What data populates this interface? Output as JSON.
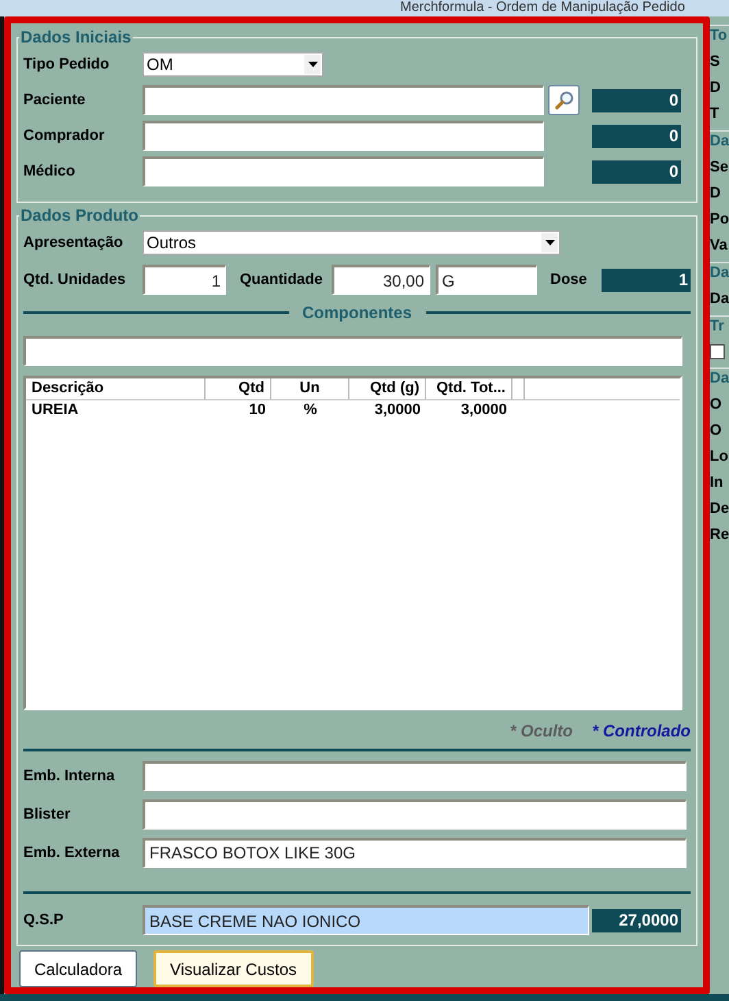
{
  "window": {
    "title": "Merchformula - Ordem de Manipulação Pedido"
  },
  "dados_iniciais": {
    "title": "Dados Iniciais",
    "fields": [
      {
        "kind": "select",
        "label": "Tipo Pedido",
        "value": "OM"
      },
      {
        "kind": "lookup",
        "label": "Paciente",
        "code": "0"
      },
      {
        "kind": "text",
        "label": "Comprador",
        "code": "0"
      },
      {
        "kind": "text",
        "label": "Médico",
        "code": "0"
      }
    ]
  },
  "dados_produto": {
    "title": "Dados Produto",
    "apresentacao": {
      "label": "Apresentação",
      "value": "Outros"
    },
    "qtd_unidades": {
      "label": "Qtd. Unidades",
      "value": "1"
    },
    "quantidade": {
      "label": "Quantidade",
      "value": "30,00",
      "unit": "G"
    },
    "dose": {
      "label": "Dose",
      "value": "1"
    },
    "componentes": {
      "title": "Componentes"
    },
    "table": {
      "columns": [
        "Descrição",
        "Qtd",
        "Un",
        "Qtd (g)",
        "Qtd. Tot..."
      ],
      "rows": [
        [
          "UREIA",
          "10",
          "%",
          "3,0000",
          "3,0000"
        ]
      ]
    },
    "legend": [
      {
        "text": "* Oculto",
        "color": "#5c5c5c"
      },
      {
        "text": "* Controlado",
        "color": "#1616a0"
      }
    ],
    "embalagens": [
      {
        "label": "Emb. Interna"
      },
      {
        "label": "Blister"
      },
      {
        "label": "Emb. Externa",
        "value": "FRASCO BOTOX LIKE 30G"
      }
    ],
    "qsp": {
      "label": "Q.S.P",
      "value": "BASE CREME NAO IONICO",
      "total": "27,0000"
    }
  },
  "buttons": [
    {
      "label": "Calculadora",
      "focused": false
    },
    {
      "label": "Visualizar Custos",
      "focused": true
    }
  ],
  "side_panel": [
    {
      "title": "To",
      "labels": [
        "S",
        "D",
        "T"
      ]
    },
    {
      "title": "Da",
      "labels": [
        "Se",
        "D",
        "Po",
        "Va"
      ]
    },
    {
      "title": "Da",
      "labels": [
        "Da"
      ]
    },
    {
      "title": "Tr",
      "checkbox": {
        "checked": false
      }
    },
    {
      "title": "Da",
      "labels": [
        "O",
        "O",
        "Lo",
        "In",
        "De",
        "Re"
      ]
    }
  ]
}
